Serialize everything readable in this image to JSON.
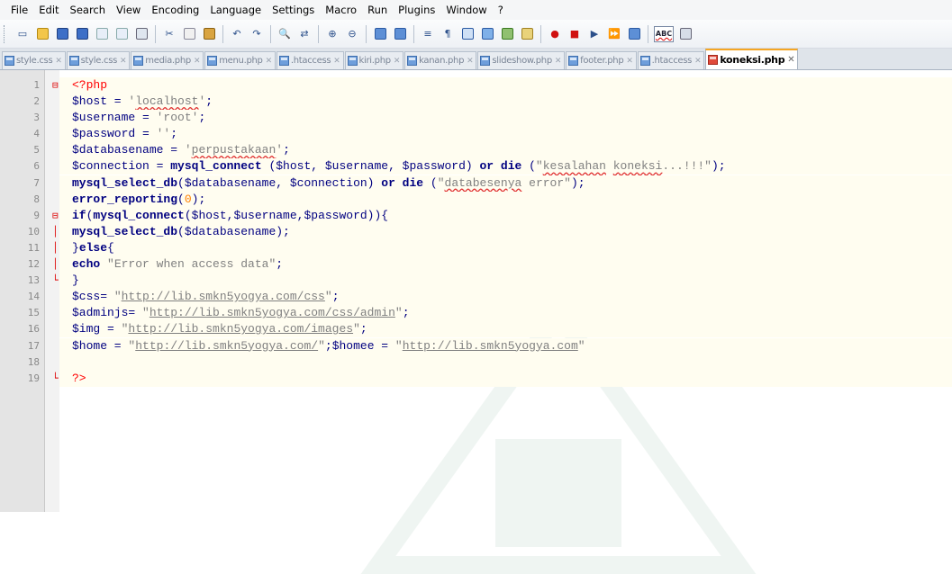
{
  "menu": [
    "File",
    "Edit",
    "Search",
    "View",
    "Encoding",
    "Language",
    "Settings",
    "Macro",
    "Run",
    "Plugins",
    "Window",
    "?"
  ],
  "toolbar": {
    "icons": [
      "new-file-icon",
      "open-file-icon",
      "save-icon",
      "save-all-icon",
      "close-icon",
      "close-all-icon",
      "print-icon",
      "cut-icon",
      "copy-icon",
      "paste-icon",
      "undo-icon",
      "redo-icon",
      "find-icon",
      "replace-icon",
      "zoom-in-icon",
      "zoom-out-icon",
      "sync-vertical-icon",
      "sync-horizontal-icon",
      "word-wrap-icon",
      "show-all-chars-icon",
      "indent-guide-icon",
      "document-map-icon",
      "function-list-icon",
      "folder-workspace-icon",
      "record-macro-icon",
      "stop-recording-icon",
      "play-macro-icon",
      "run-macro-multiple-icon",
      "save-macro-icon",
      "spell-check-icon",
      "spell-check-settings-icon"
    ],
    "spell_label": "ABC"
  },
  "tabs": [
    {
      "label": "style.css",
      "active": false
    },
    {
      "label": "style.css",
      "active": false
    },
    {
      "label": "media.php",
      "active": false
    },
    {
      "label": "menu.php",
      "active": false
    },
    {
      "label": ".htaccess",
      "active": false
    },
    {
      "label": "kiri.php",
      "active": false
    },
    {
      "label": "kanan.php",
      "active": false
    },
    {
      "label": "slideshow.php",
      "active": false
    },
    {
      "label": "footer.php",
      "active": false
    },
    {
      "label": ".htaccess",
      "active": false
    },
    {
      "label": "koneksi.php",
      "active": true
    }
  ],
  "tab_close_glyph": "✕",
  "lines": [
    {
      "no": "1",
      "fold": "⊟",
      "tokens": [
        [
          "t",
          "<?php"
        ]
      ]
    },
    {
      "no": "2",
      "fold": "",
      "tokens": [
        [
          "v",
          "$host = "
        ],
        [
          "s",
          "'"
        ],
        [
          "sw",
          "localhost"
        ],
        [
          "s",
          "'"
        ],
        [
          "v",
          ";"
        ]
      ]
    },
    {
      "no": "3",
      "fold": "",
      "tokens": [
        [
          "v",
          "$username = "
        ],
        [
          "s",
          "'root'"
        ],
        [
          "v",
          ";"
        ]
      ]
    },
    {
      "no": "4",
      "fold": "",
      "tokens": [
        [
          "v",
          "$password = "
        ],
        [
          "s",
          "''"
        ],
        [
          "v",
          ";"
        ]
      ]
    },
    {
      "no": "5",
      "fold": "",
      "tokens": [
        [
          "v",
          "$databasename = "
        ],
        [
          "s",
          "'"
        ],
        [
          "sw",
          "perpustakaan"
        ],
        [
          "s",
          "'"
        ],
        [
          "v",
          ";"
        ]
      ]
    },
    {
      "no": "6",
      "fold": "",
      "tokens": [
        [
          "v",
          "$connection = "
        ],
        [
          "k",
          "mysql_connect"
        ],
        [
          "v",
          " ($host, $username, $password) "
        ],
        [
          "k",
          "or die"
        ],
        [
          "v",
          " ("
        ],
        [
          "s",
          "\""
        ],
        [
          "sw",
          "kesalahan"
        ],
        [
          "s",
          " "
        ],
        [
          "sw",
          "koneksi"
        ],
        [
          "s",
          "...!!!\""
        ],
        [
          "v",
          ");"
        ]
      ]
    },
    {
      "no": "7",
      "fold": "",
      "tokens": [
        [
          "k",
          "mysql_select_db"
        ],
        [
          "v",
          "($databasename, $connection) "
        ],
        [
          "k",
          "or die"
        ],
        [
          "v",
          " ("
        ],
        [
          "s",
          "\""
        ],
        [
          "sw",
          "databesenya"
        ],
        [
          "s",
          " error\""
        ],
        [
          "v",
          ");"
        ]
      ]
    },
    {
      "no": "8",
      "fold": "",
      "tokens": [
        [
          "k",
          "error_reporting"
        ],
        [
          "v",
          "("
        ],
        [
          "n",
          "0"
        ],
        [
          "v",
          ");"
        ]
      ]
    },
    {
      "no": "9",
      "fold": "⊟",
      "tokens": [
        [
          "k",
          "if"
        ],
        [
          "v",
          "("
        ],
        [
          "k",
          "mysql_connect"
        ],
        [
          "v",
          "($host,$username,$password)){"
        ]
      ]
    },
    {
      "no": "10",
      "fold": "│",
      "tokens": [
        [
          "k",
          "mysql_select_db"
        ],
        [
          "v",
          "($databasename);"
        ]
      ]
    },
    {
      "no": "11",
      "fold": "│",
      "tokens": [
        [
          "v",
          "}"
        ],
        [
          "k",
          "else"
        ],
        [
          "v",
          "{"
        ]
      ]
    },
    {
      "no": "12",
      "fold": "│",
      "tokens": [
        [
          "k",
          "echo"
        ],
        [
          "v",
          " "
        ],
        [
          "s",
          "\"Error when access data\""
        ],
        [
          "v",
          ";"
        ]
      ]
    },
    {
      "no": "13",
      "fold": "└",
      "tokens": [
        [
          "v",
          "}"
        ]
      ]
    },
    {
      "no": "14",
      "fold": "",
      "tokens": [
        [
          "v",
          "$css= "
        ],
        [
          "s",
          "\""
        ],
        [
          "su",
          "http://lib.smkn5yogya.com/css"
        ],
        [
          "s",
          "\""
        ],
        [
          "v",
          ";"
        ]
      ]
    },
    {
      "no": "15",
      "fold": "",
      "tokens": [
        [
          "v",
          "$adminjs= "
        ],
        [
          "s",
          "\""
        ],
        [
          "su",
          "http://lib.smkn5yogya.com/css/admin"
        ],
        [
          "s",
          "\""
        ],
        [
          "v",
          ";"
        ]
      ]
    },
    {
      "no": "16",
      "fold": "",
      "tokens": [
        [
          "v",
          "$img = "
        ],
        [
          "s",
          "\""
        ],
        [
          "su",
          "http://lib.smkn5yogya.com/images"
        ],
        [
          "s",
          "\""
        ],
        [
          "v",
          ";"
        ]
      ]
    },
    {
      "no": "17",
      "fold": "",
      "tokens": [
        [
          "v",
          "$home = "
        ],
        [
          "s",
          "\""
        ],
        [
          "su",
          "http://lib.smkn5yogya.com/"
        ],
        [
          "s",
          "\""
        ],
        [
          "v",
          ";$homee = "
        ],
        [
          "s",
          "\""
        ],
        [
          "su",
          "http://lib.smkn5yogya.com"
        ],
        [
          "s",
          "\""
        ]
      ]
    },
    {
      "no": "18",
      "fold": "",
      "tokens": []
    },
    {
      "no": "19",
      "fold": "└",
      "tokens": [
        [
          "t",
          "?>"
        ]
      ]
    }
  ],
  "colors": {
    "variable": "#000080",
    "string": "#808080",
    "keyword": "#000080",
    "php_tag": "#ff0000",
    "number": "#ff8000",
    "active_tab_accent": "#f5a623",
    "line_highlight": "#fffdf0"
  }
}
